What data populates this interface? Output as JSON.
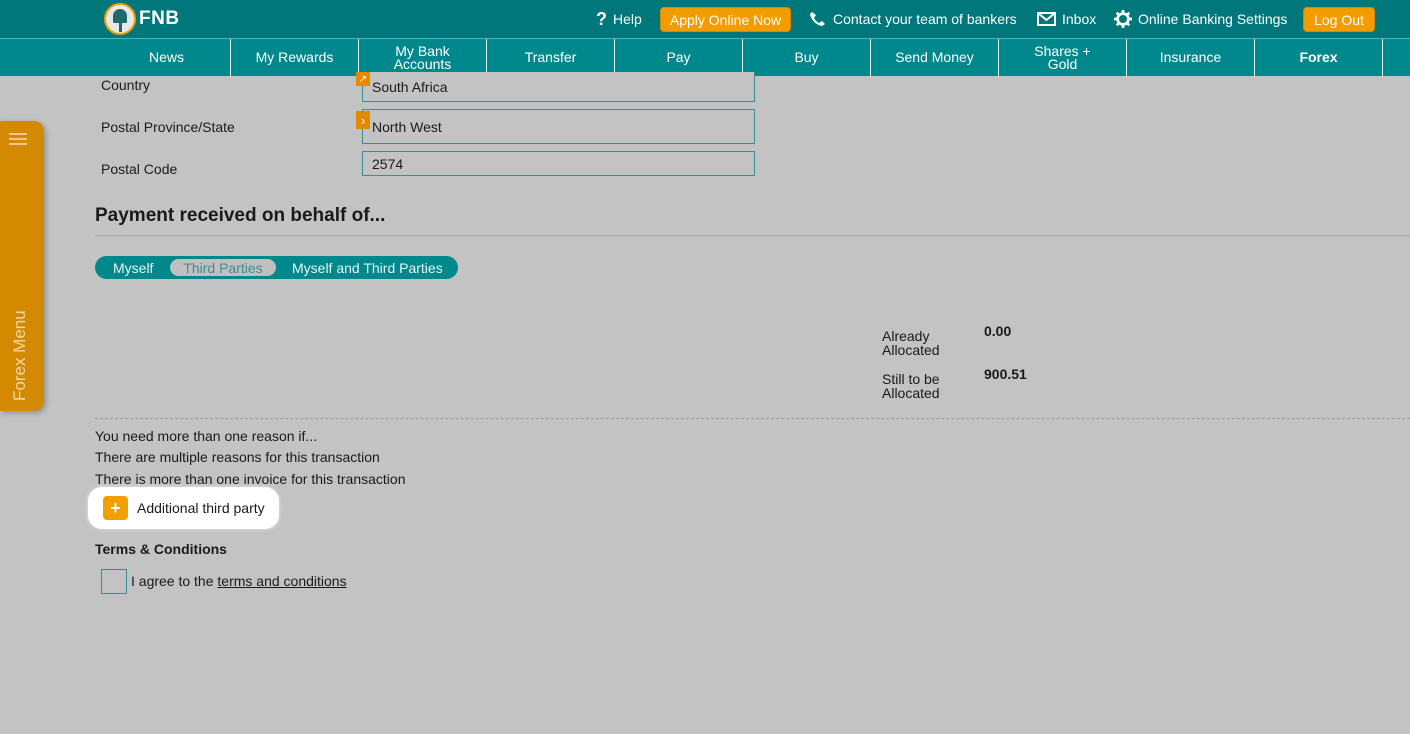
{
  "topbar": {
    "logo_text": "FNB",
    "help": "Help",
    "apply": "Apply Online Now",
    "contact": "Contact your team of bankers",
    "inbox": "Inbox",
    "settings": "Online Banking Settings",
    "logout": "Log Out"
  },
  "nav": {
    "items": [
      "News",
      "My Rewards",
      "My Bank\nAccounts",
      "Transfer",
      "Pay",
      "Buy",
      "Send Money",
      "Shares +\nGold",
      "Insurance",
      "Forex"
    ]
  },
  "side_tab": {
    "label": "Forex Menu"
  },
  "form": {
    "country": {
      "label": "Country",
      "value": "South Africa"
    },
    "province": {
      "label": "Postal Province/State",
      "value": "North West"
    },
    "postal_code": {
      "label": "Postal Code",
      "value": "2574"
    }
  },
  "section": {
    "title": "Payment received on behalf of...",
    "options": [
      "Myself",
      "Third Parties",
      "Myself and Third Parties"
    ],
    "selected": "Third Parties"
  },
  "allocation": {
    "already_label": "Already\nAllocated",
    "already_value": "0.00",
    "still_label": "Still to be\nAllocated",
    "still_value": "900.51"
  },
  "info": {
    "line1": "You need more than one reason if...",
    "line2": "There are multiple reasons for this transaction",
    "line3": "There is more than one invoice for this transaction"
  },
  "add_button": {
    "icon": "+",
    "label": "Additional third party"
  },
  "terms": {
    "title": "Terms & Conditions",
    "agree_prefix": "I agree to the ",
    "link": "terms and conditions"
  },
  "colors": {
    "teal_dark": "#00777a",
    "teal": "#00888c",
    "orange": "#f39c00",
    "background": "#c3c3c3"
  }
}
